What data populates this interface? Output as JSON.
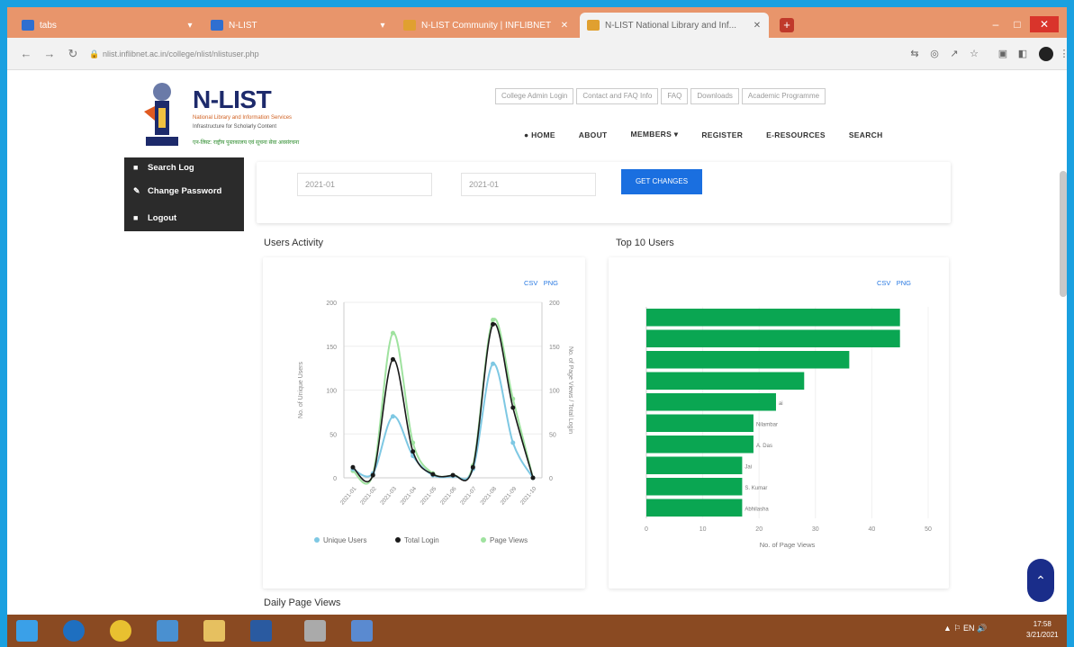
{
  "browser": {
    "tabs": [
      {
        "label": "tabs",
        "icon": "page-favicon"
      },
      {
        "label": "N-LIST",
        "icon": "page-favicon"
      },
      {
        "label": "N-LIST Community | INFLIBNET",
        "icon": "page-favicon"
      },
      {
        "label": "N-LIST National Library and Inf...",
        "icon": "page-favicon",
        "active": true
      }
    ],
    "new_tab": "+",
    "window_buttons": {
      "minimize": "–",
      "maximize": "□",
      "close": "✕"
    },
    "url": "nlist.inflibnet.ac.in/college/nlist/nlistuser.php",
    "nav": {
      "back": "←",
      "forward": "→",
      "reload": "↻"
    }
  },
  "site": {
    "logo_title": "N-LIST",
    "logo_lines": [
      "National Library and Information Services",
      "Infrastructure for Scholarly Content",
      "एन-लिस्ट: राष्ट्रीय पुस्तकालय एवं सूचना सेवा अवसंरचना"
    ],
    "top_links": [
      "College Admin Login",
      "Contact and FAQ Info",
      "FAQ",
      "Downloads",
      "Academic Programme"
    ],
    "nav_items": [
      "● HOME",
      "ABOUT",
      "MEMBERS ▾",
      "REGISTER",
      "E-RESOURCES",
      "SEARCH"
    ]
  },
  "side_menu": {
    "items": [
      {
        "label": "Search Log",
        "icon": "list-icon"
      },
      {
        "label": "Change Password",
        "icon": "key-icon"
      },
      {
        "label": "Logout",
        "icon": "logout-icon"
      }
    ]
  },
  "filters": {
    "from_date": "2021-01",
    "to_date": "2021-01",
    "button": "GET CHANGES"
  },
  "sections": {
    "users_activity": "Users Activity",
    "top_users": "Top 10 Users",
    "daily_page_views": "Daily Page Views"
  },
  "card_links": {
    "csv": "CSV",
    "print": "PNG"
  },
  "chart_data": [
    {
      "type": "line",
      "title": "Users Activity",
      "ylabel": "No. of Unique Users",
      "y2label": "No. of Page Views / Total Login",
      "ylim": [
        0,
        200
      ],
      "y2lim": [
        0,
        200
      ],
      "yticks": [
        "0",
        "50",
        "100",
        "150",
        "200"
      ],
      "y2ticks": [
        "0",
        "50",
        "100",
        "150",
        "200"
      ],
      "categories": [
        "2021-01",
        "2021-02",
        "2021-03",
        "2021-04",
        "2021-05",
        "2021-06",
        "2021-07",
        "2021-08",
        "2021-09",
        "2021-10"
      ],
      "series": [
        {
          "name": "Unique Users",
          "color": "#7ec8e3",
          "values": [
            10,
            5,
            70,
            25,
            3,
            2,
            10,
            130,
            40,
            0
          ]
        },
        {
          "name": "Total Login",
          "color": "#1a1a1a",
          "values": [
            12,
            3,
            135,
            30,
            4,
            3,
            12,
            175,
            80,
            0
          ]
        },
        {
          "name": "Page Views",
          "color": "#9fe29f",
          "values": [
            8,
            4,
            165,
            40,
            5,
            3,
            14,
            180,
            90,
            0
          ]
        }
      ]
    },
    {
      "type": "bar",
      "orientation": "horizontal",
      "title": "Top 10 Users",
      "xlabel": "No. of Page Views",
      "xticks": [
        "0",
        "10",
        "20",
        "30",
        "40",
        "50"
      ],
      "xlim": [
        0,
        50
      ],
      "color": "#0aa652",
      "categories": [
        "",
        "",
        "",
        "",
        "",
        "",
        "",
        "",
        "",
        ""
      ],
      "values": [
        45,
        45,
        36,
        28,
        23,
        19,
        19,
        17,
        17,
        17
      ],
      "bar_labels": [
        "",
        "",
        "",
        "",
        "ai",
        "Nilambar",
        "A. Das",
        "Jai",
        "S. Kumar",
        "Abhilasha"
      ]
    }
  ],
  "taskbar": {
    "icons": [
      "windows-start",
      "internet-explorer",
      "chrome",
      "file-explorer",
      "folder",
      "media",
      "word",
      "photos"
    ],
    "tray": "▲  ⚐  EN  🔊",
    "time": "17:58",
    "date": "3/21/2021"
  },
  "colors": {
    "frame": "#1aa0e0",
    "tabbar": "#e8956b",
    "taskbar": "#8a4a22",
    "accent_button": "#1a6fe0",
    "bar_green": "#0aa652",
    "logo_navy": "#1d2a6b"
  }
}
